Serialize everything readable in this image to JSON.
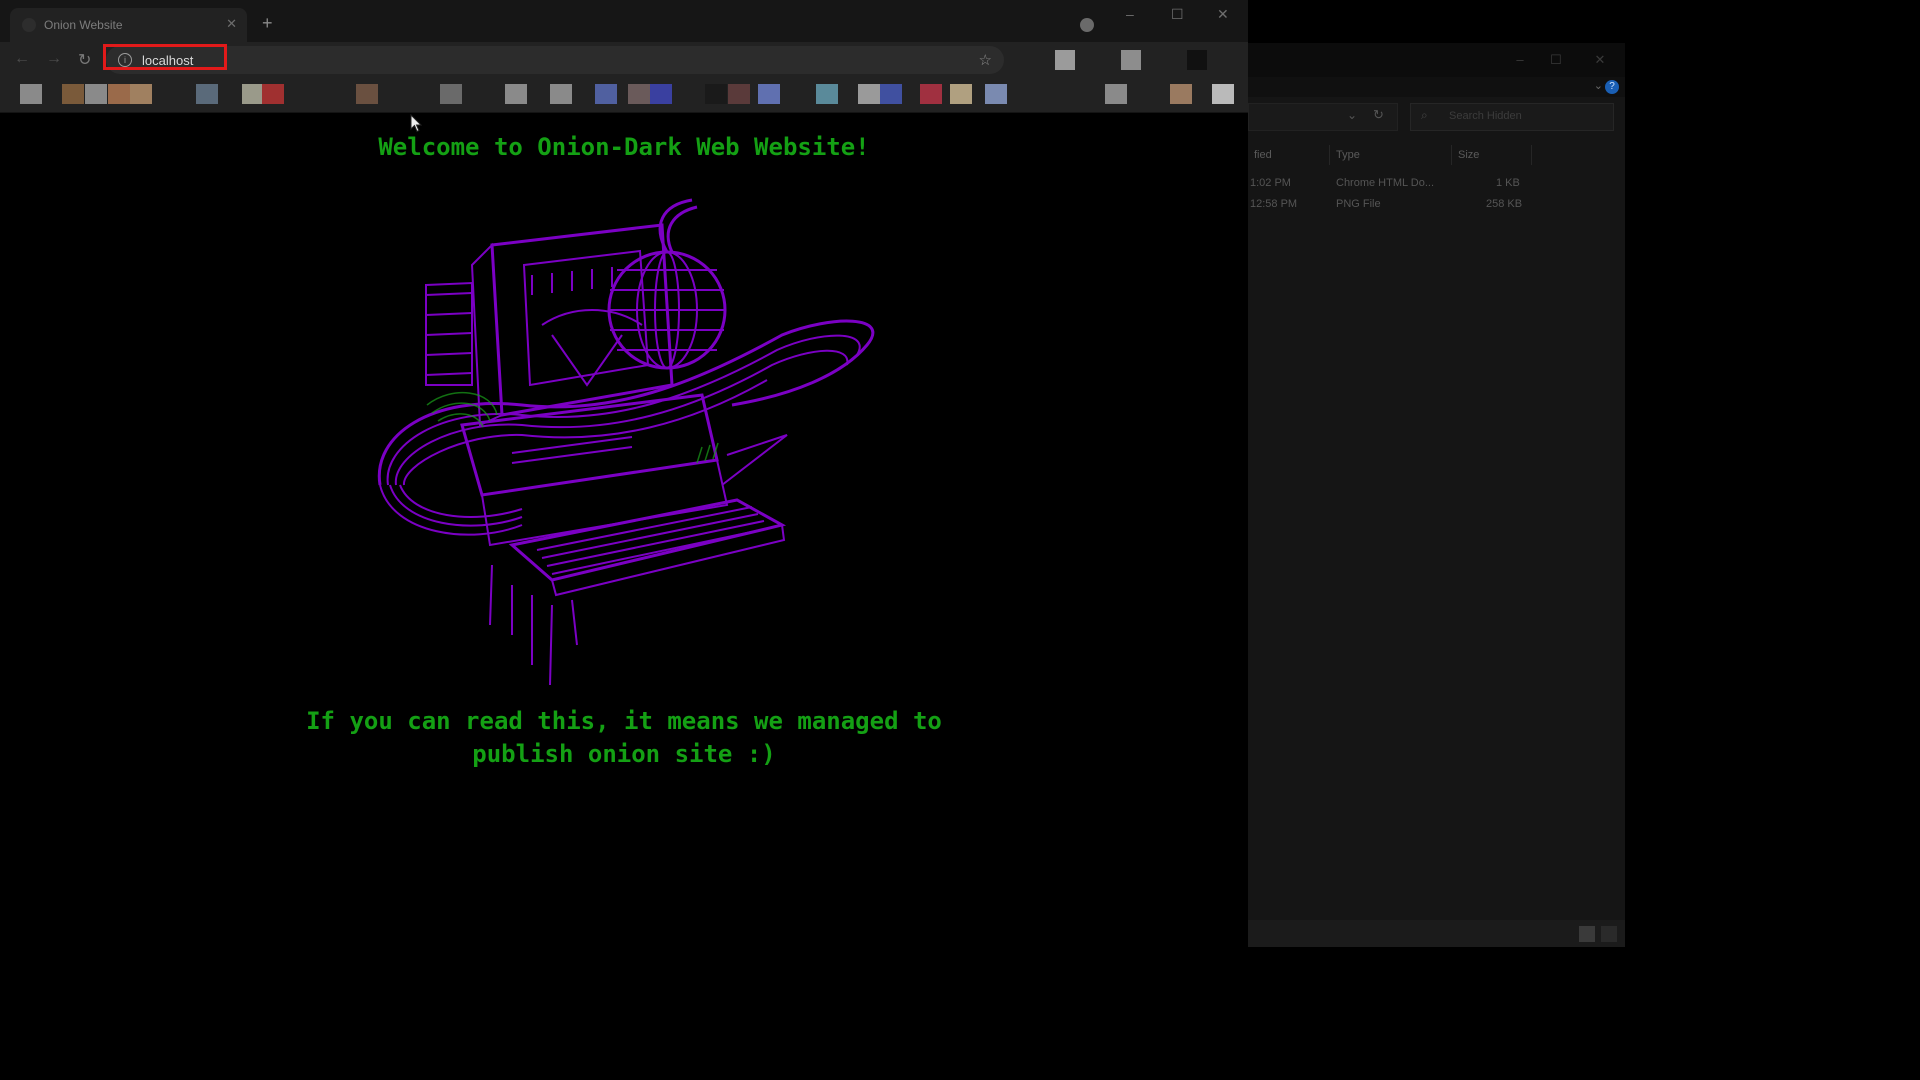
{
  "browser": {
    "tab": {
      "title": "Onion Website",
      "close_glyph": "✕"
    },
    "new_tab_glyph": "+",
    "window_controls": {
      "minimize": "–",
      "maximize": "☐",
      "close": "✕"
    },
    "nav": {
      "back_glyph": "←",
      "forward_glyph": "→",
      "reload_glyph": "↻"
    },
    "address": {
      "info_glyph": "i",
      "url": "localhost",
      "highlight_color": "#e21a1a"
    },
    "star_glyph": "☆",
    "extensions": [
      "#9b9b9b",
      "#8d8d8d",
      "#111111"
    ],
    "bookmarks": [
      "#8a8a8a",
      "#7a5a3a",
      "#8a8a8a",
      "#9a6a4a",
      "#a08060",
      "#5a6a7a",
      "#9a9a8a",
      "#a03030",
      "#6a5040",
      "#6a6a6a",
      "#8a8a8a",
      "#8a8a8a",
      "#5060a0",
      "#6a5a5a",
      "#3a40a0",
      "#1a1a1a",
      "#5a3a3a",
      "#6070b0",
      "#5a8a9a",
      "#9a9a9a",
      "#4050a0",
      "#a03040",
      "#b0a080",
      "#7a8ab0",
      "#8a8a8a",
      "#9a7a60",
      "#bababa"
    ]
  },
  "page": {
    "heading": "Welcome to Onion-Dark Web Website!",
    "message_line1": "If you can read this, it means we managed to",
    "message_line2": "publish onion site :)",
    "text_color": "#14a014",
    "art_color": "#7b00c4",
    "art_accent": "#1aa01a"
  },
  "explorer": {
    "window_controls": {
      "minimize": "–",
      "maximize": "☐",
      "close": "✕"
    },
    "search_placeholder": "Search Hidden",
    "columns": {
      "modified": "fied",
      "type": "Type",
      "size": "Size"
    },
    "rows": [
      {
        "modified": "1:02 PM",
        "type": "Chrome HTML Do...",
        "size": "1 KB"
      },
      {
        "modified": "12:58 PM",
        "type": "PNG File",
        "size": "258 KB"
      }
    ]
  }
}
